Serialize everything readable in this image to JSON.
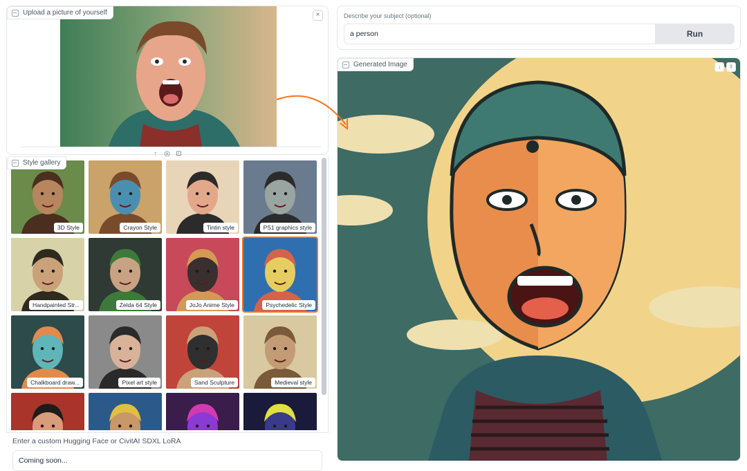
{
  "upload": {
    "label": "Upload a picture of yourself",
    "close_glyph": "×",
    "tools": [
      "↑",
      "◎",
      "⊡"
    ]
  },
  "gallery": {
    "label": "Style gallery",
    "items": [
      {
        "caption": "3D Style",
        "colors": [
          "#6a8b4a",
          "#4a2e1f",
          "#b7855e"
        ]
      },
      {
        "caption": "Crayon Style",
        "colors": [
          "#c9a36a",
          "#7a4b2a",
          "#4a8fb0"
        ]
      },
      {
        "caption": "Tintin style",
        "colors": [
          "#e8d5b8",
          "#2b2b2b",
          "#e3a88a"
        ]
      },
      {
        "caption": "PS1 graphics style",
        "colors": [
          "#6a7b8f",
          "#2b2b2b",
          "#9aa4a0"
        ]
      },
      {
        "caption": "Handpainted Str...",
        "colors": [
          "#d8d2a8",
          "#2e2a20",
          "#c9a27a"
        ]
      },
      {
        "caption": "Zelda 64 Style",
        "colors": [
          "#2f3a34",
          "#3d7a3a",
          "#c7a283"
        ]
      },
      {
        "caption": "JoJo Anime Style",
        "colors": [
          "#c7495a",
          "#d49a55",
          "#3a2f2f"
        ]
      },
      {
        "caption": "Psychedelic Style",
        "colors": [
          "#2f6fb0",
          "#d3634a",
          "#e6cd60"
        ]
      },
      {
        "caption": "Chalkboard draw...",
        "colors": [
          "#2c4b4a",
          "#e28a4c",
          "#5fb6b8"
        ]
      },
      {
        "caption": "Pixel art style",
        "colors": [
          "#8a8a8a",
          "#2a2a2a",
          "#d9b29a"
        ]
      },
      {
        "caption": "Sand Sculpture",
        "colors": [
          "#c0443a",
          "#caa27a",
          "#2f2f2f"
        ]
      },
      {
        "caption": "Medieval style",
        "colors": [
          "#d9c9a0",
          "#7a5a3a",
          "#c39b75"
        ]
      },
      {
        "caption": "",
        "colors": [
          "#a8342a",
          "#1d1b1b",
          "#d99c7a"
        ]
      },
      {
        "caption": "",
        "colors": [
          "#2b5a8a",
          "#e0c040",
          "#c9976a"
        ]
      },
      {
        "caption": "",
        "colors": [
          "#3a1d4a",
          "#d43ab0",
          "#8b3ad4"
        ]
      },
      {
        "caption": "",
        "colors": [
          "#1a1a3a",
          "#e0e040",
          "#3a3a8a"
        ]
      }
    ]
  },
  "lora": {
    "label": "Enter a custom Hugging Face or CivitAI SDXL LoRA",
    "value": "Coming soon..."
  },
  "prompt": {
    "label": "Describe your subject (optional)",
    "value": "a person",
    "run_label": "Run"
  },
  "output": {
    "label": "Generated Image",
    "icons": [
      "download-icon",
      "share-icon"
    ]
  },
  "accent": "#f97316"
}
